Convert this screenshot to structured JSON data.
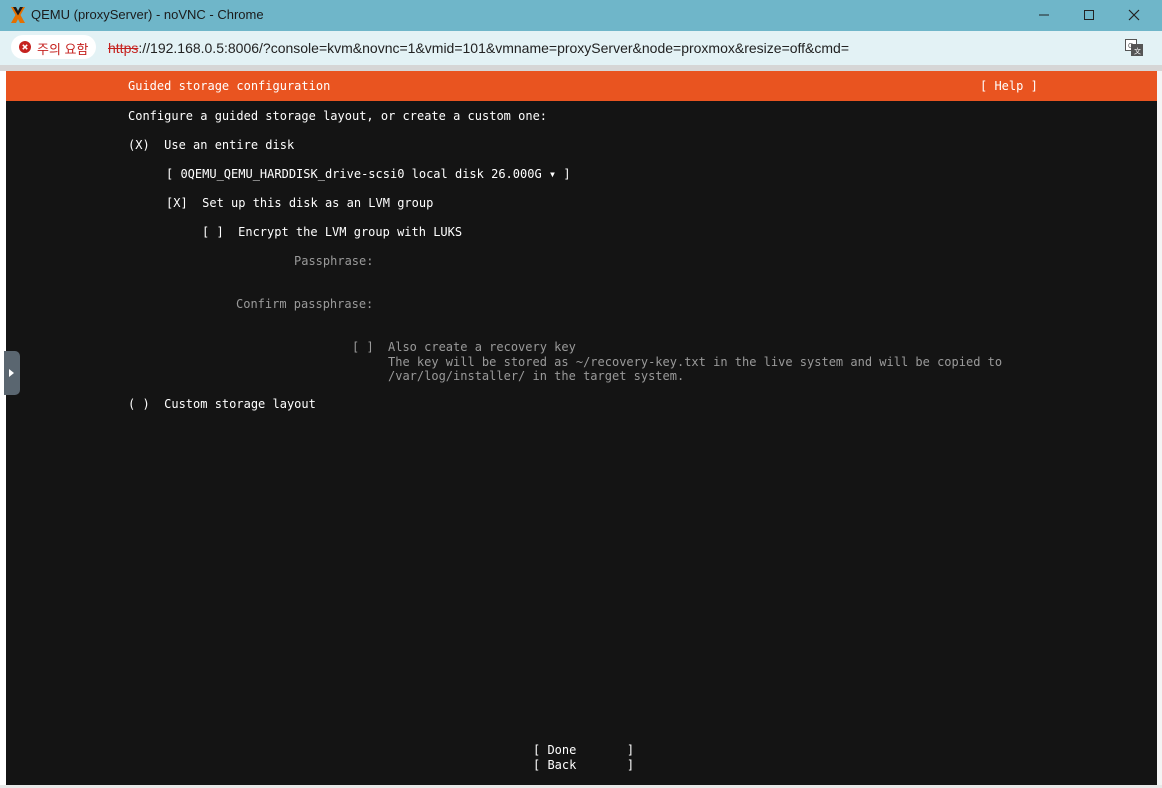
{
  "window": {
    "title": "QEMU (proxyServer) - noVNC - Chrome",
    "app_icon": "proxmox-x-logo",
    "controls": [
      "minimize-icon",
      "maximize-icon",
      "close-icon"
    ]
  },
  "address_bar": {
    "security_label": "주의 요함",
    "security_icon": "warning-circle-icon",
    "url_scheme": "https",
    "url_rest": "://192.168.0.5:8006/?console=kvm&novnc=1&vmid=101&vmname=proxyServer&node=proxmox&resize=off&cmd=",
    "translate_icon": "translate-icon"
  },
  "colors": {
    "header_orange": "#e95420",
    "terminal_bg": "#141414",
    "titlebar": "#6fb6c9"
  },
  "installer": {
    "header_title": "Guided storage configuration",
    "help": "[ Help ]",
    "intro": "Configure a guided storage layout, or create a custom one:",
    "entire_disk": "(X)  Use an entire disk",
    "disk_select": "[ 0QEMU_QEMU_HARDDISK_drive-scsi0 local disk 26.000G ▾ ]",
    "lvm": "[X]  Set up this disk as an LVM group",
    "luks": "[ ]  Encrypt the LVM group with LUKS",
    "passphrase_label": "Passphrase:",
    "confirm_label": "Confirm passphrase:",
    "recovery_checkbox": "[ ]",
    "recovery_title": "Also create a recovery key",
    "recovery_desc1": "The key will be stored as ~/recovery-key.txt in the live system and will be copied to",
    "recovery_desc2": "/var/log/installer/ in the target system.",
    "custom_layout": "( )  Custom storage layout",
    "done": "[ Done       ]",
    "back": "[ Back       ]"
  }
}
